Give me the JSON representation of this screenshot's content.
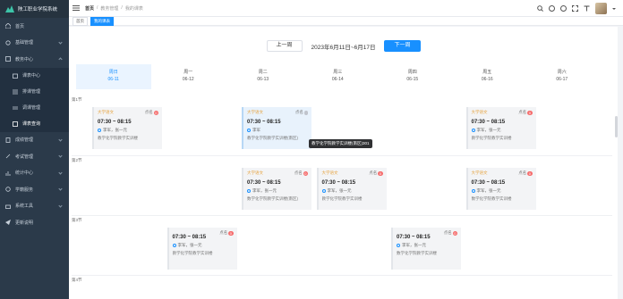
{
  "app": {
    "title": "陕工职业学院系统"
  },
  "sidebar": {
    "items": [
      {
        "label": "首页",
        "icon": "home-icon"
      },
      {
        "label": "基础管理",
        "icon": "settings-icon"
      },
      {
        "label": "教务中心",
        "icon": "grid-icon"
      }
    ],
    "subitems": [
      {
        "label": "课表中心"
      },
      {
        "label": "排课管理"
      },
      {
        "label": "调课管理"
      },
      {
        "label": "课表查询"
      }
    ],
    "more": [
      {
        "label": "成绩管理",
        "icon": "document-icon"
      },
      {
        "label": "考试管理",
        "icon": "edit-icon"
      },
      {
        "label": "统计中心",
        "icon": "chart-icon"
      },
      {
        "label": "学籍服务",
        "icon": "pie-icon"
      },
      {
        "label": "系统工具",
        "icon": "tools-icon"
      },
      {
        "label": "更新说明",
        "icon": "send-icon"
      }
    ]
  },
  "topbar": {
    "breadcrumb": [
      "首页",
      "教务管理",
      "我的课表"
    ],
    "icons": [
      "search-icon",
      "github-icon",
      "help-icon",
      "fullscreen-icon",
      "font-size-icon"
    ]
  },
  "tabs": [
    {
      "label": "首页"
    },
    {
      "label": "我的课表",
      "active": true
    }
  ],
  "weeknav": {
    "prev": "上一周",
    "range": "2023年6月11日~6月17日",
    "next": "下一周"
  },
  "days": [
    {
      "name": "周日",
      "date": "06-11",
      "today": true
    },
    {
      "name": "周一",
      "date": "06-12"
    },
    {
      "name": "周二",
      "date": "06-13"
    },
    {
      "name": "周三",
      "date": "06-14"
    },
    {
      "name": "周四",
      "date": "06-15"
    },
    {
      "name": "周五",
      "date": "06-16"
    },
    {
      "name": "周六",
      "date": "06-17"
    }
  ],
  "slots": [
    "第1节",
    "第2节",
    "第3节",
    "第4节"
  ],
  "cards": [
    {
      "slot": 0,
      "day": 0,
      "type": "大学语文",
      "status": "点名",
      "badge": "0",
      "time": "07:30 ~ 08:15",
      "teacher": "李军，张一元",
      "room": "教学化学院教学实训楼"
    },
    {
      "slot": 0,
      "day": 2,
      "type": "大学语文",
      "status": "点名",
      "badge": "",
      "time": "07:30 ~ 08:15",
      "teacher": "李军",
      "room": "教学化学院教学实训楼(南区)",
      "hl": true
    },
    {
      "slot": 0,
      "day": 5,
      "type": "大学语文",
      "status": "点名",
      "badge": "0",
      "time": "07:30 ~ 08:15",
      "teacher": "李军，张一元",
      "room": "教学化学院教学实训楼"
    },
    {
      "slot": 1,
      "day": 2,
      "type": "大学语文",
      "status": "点名",
      "badge": "0",
      "time": "07:30 ~ 08:15",
      "teacher": "李军，张一元",
      "room": "数学化学院教学实训楼(南区)"
    },
    {
      "slot": 1,
      "day": 3,
      "type": "大学语文",
      "status": "点名",
      "badge": "0",
      "time": "07:30 ~ 08:15",
      "teacher": "李军，张一元",
      "room": "教学化学院教学实训楼"
    },
    {
      "slot": 1,
      "day": 5,
      "type": "大学语文",
      "status": "点名",
      "badge": "0",
      "time": "07:30 ~ 08:15",
      "teacher": "李军，张一元",
      "room": "数学化学院教学实训楼"
    },
    {
      "slot": 2,
      "day": 1,
      "type": "",
      "status": "点名",
      "badge": "0",
      "time": "07:30 ~ 08:15",
      "teacher": "李军，张一元",
      "room": "教学化学院教学实训楼"
    },
    {
      "slot": 2,
      "day": 4,
      "type": "",
      "status": "点名",
      "badge": "0",
      "time": "07:30 ~ 08:15",
      "teacher": "李军，张一元",
      "room": "数学化学院教学实训楼"
    }
  ],
  "tooltip": "教学化学院教学实训楼(南区)301"
}
